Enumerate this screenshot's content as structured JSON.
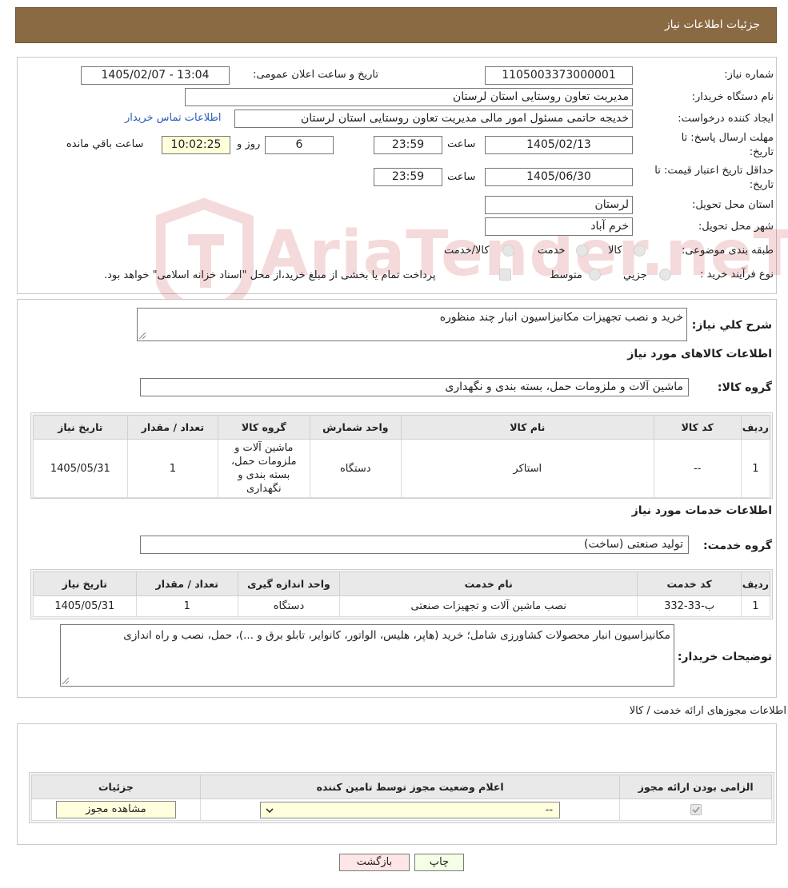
{
  "header": {
    "title": "جزئیات اطلاعات نیاز"
  },
  "form": {
    "need_number_label": "شماره نیاز:",
    "need_number": "1105003373000001",
    "announce_label": "تاریخ و ساعت اعلان عمومی:",
    "announce_value": "1405/02/07 - 13:04",
    "buyer_label": "نام دستگاه خریدار:",
    "buyer_value": "مدیریت تعاون روستایی استان لرستان",
    "creator_label": "ایجاد کننده درخواست:",
    "creator_value": "خدیجه حاتمی مسئول امور مالی مدیریت تعاون روستایی استان لرستان",
    "contact_link": "اطلاعات تماس خریدار",
    "deadline_label_1": "مهلت ارسال پاسخ: تا",
    "deadline_label_2": "تاریخ:",
    "deadline_date": "1405/02/13",
    "time_label": "ساعت",
    "deadline_time": "23:59",
    "days_value": "6",
    "days_label": "روز و",
    "remaining_value": "10:02:25",
    "remaining_label": "ساعت باقي مانده",
    "validity_label_1": "حداقل تاریخ اعتبار قیمت: تا",
    "validity_label_2": "تاریخ:",
    "validity_date": "1405/06/30",
    "validity_time": "23:59",
    "province_label": "استان محل تحویل:",
    "province_value": "لرستان",
    "city_label": "شهر محل تحویل:",
    "city_value": "خرم آباد",
    "category_label": "طبقه بندی موضوعی:",
    "category_options": [
      "کالا",
      "خدمت",
      "کالا/خدمت"
    ],
    "process_label": "نوع فرآیند خرید :",
    "process_options": [
      "جزیي",
      "متوسط"
    ],
    "process_note": "پرداخت تمام یا بخشی از مبلغ خرید،از محل \"اسناد خزانه اسلامی\" خواهد بود."
  },
  "description": {
    "label": "شرح کلي نياز:",
    "value": "خرید و نصب تجهیزات مکانیزاسیون انبار چند منظوره"
  },
  "goods": {
    "section_title": "اطلاعات کالاهای مورد نیاز",
    "group_label": "گروه کالا:",
    "group_value": "ماشین آلات و ملزومات حمل، بسته بندی و نگهداری",
    "columns": [
      "ردیف",
      "کد کالا",
      "نام کالا",
      "واحد شمارش",
      "گروه کالا",
      "تعداد / مقدار",
      "تاریخ نیاز"
    ],
    "rows": [
      {
        "row": "1",
        "code": "--",
        "name": "استاکر",
        "unit": "دستگاه",
        "group": "ماشین آلات و ملزومات حمل، بسته بندی و نگهداری",
        "qty": "1",
        "date": "1405/05/31"
      }
    ]
  },
  "services": {
    "section_title": "اطلاعات خدمات مورد نیاز",
    "group_label": "گروه خدمت:",
    "group_value": "تولید صنعتی (ساخت)",
    "columns": [
      "ردیف",
      "کد خدمت",
      "نام خدمت",
      "واحد اندازه گیری",
      "تعداد / مقدار",
      "تاریخ نیاز"
    ],
    "rows": [
      {
        "row": "1",
        "code": "ب-33-332",
        "name": "نصب ماشین آلات و تجهیزات صنعتی",
        "unit": "دستگاه",
        "qty": "1",
        "date": "1405/05/31"
      }
    ]
  },
  "buyer_notes": {
    "label": "توضیحات خریدار:",
    "value": "مکانیزاسیون انبار محصولات کشاورزی شامل؛ خرید (هاپر، هلیس، الواتور، کانوایر، تابلو برق و ...)، حمل، نصب و راه اندازی"
  },
  "licenses": {
    "title": "اطلاعات مجوزهای ارائه خدمت / کالا",
    "columns": [
      "الزامی بودن ارائه مجوز",
      "اعلام وضعیت مجوز توسط تامین کننده",
      "جزئیات"
    ],
    "select_value": "--",
    "view_button": "مشاهده مجوز"
  },
  "actions": {
    "print": "چاپ",
    "back": "بازگشت"
  },
  "watermark": {
    "text": "AriaTender.neT"
  }
}
